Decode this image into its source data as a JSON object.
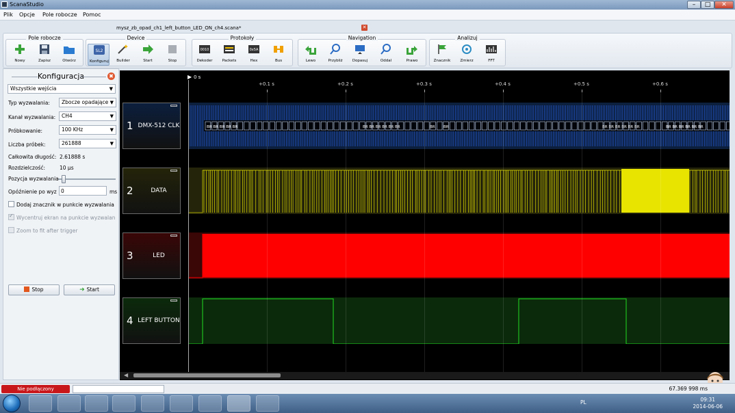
{
  "window": {
    "title": "ScanaStudio",
    "min": "–",
    "max": "□",
    "close": "✕"
  },
  "menu": [
    "Plik",
    "Opcje",
    "Pole robocze",
    "Pomoc"
  ],
  "document_tab": {
    "title": "mysz_zb_opad_ch1_left_button_LED_ON_ch4.scana*",
    "close": "✕"
  },
  "toolbar": {
    "groups": [
      {
        "title": "Pole robocze",
        "buttons": [
          "Nowy",
          "Zapisz",
          "Otwórz"
        ]
      },
      {
        "title": "Device",
        "buttons": [
          "Konfiguruj",
          "Builder",
          "Start",
          "Stop"
        ]
      },
      {
        "title": "Protokoły",
        "buttons": [
          "Dekoder",
          "Packets",
          "Hex",
          "Bus"
        ]
      },
      {
        "title": "Navigation",
        "buttons": [
          "Lewo",
          "Przybliż",
          "Dopasuj",
          "Oddal",
          "Prawo"
        ]
      },
      {
        "title": "Analizuj",
        "buttons": [
          "Znacznik",
          "Zmierz",
          "FFT"
        ]
      }
    ],
    "icon_texts": {
      "konfiguruj": "SL2",
      "dekoder": "0010",
      "hex": "0x5A"
    }
  },
  "config_panel": {
    "title": "Konfiguracja",
    "close": "✖",
    "inputs_select": "Wszystkie wejścia",
    "trigger_type_label": "Typ wyzwalania:",
    "trigger_type_value": "Zbocze opadające",
    "trigger_channel_label": "Kanał wyzwalania:",
    "trigger_channel_value": "CH4",
    "sampling_label": "Próbkowanie:",
    "sampling_value": "100 KHz",
    "samples_label": "Liczba próbek:",
    "samples_value": "261888",
    "total_length_label": "Całkowita długość:",
    "total_length_value": "2.61888 s",
    "resolution_label": "Rozdzielczość:",
    "resolution_value": "10 µs",
    "trigger_pos_label": "Pozycja wyzwalania",
    "trigger_pos_fraction": 0.1,
    "delay_label": "Opóźnienie po wyz",
    "delay_value": "0",
    "delay_unit": "ms",
    "add_marker_label": "Dodaj znacznik w punkcie wyzwalania",
    "center_label": "Wycentruj ekran na punkcie wyzwalan",
    "zoom_label": "Zoom to fit after trigger",
    "stop_button": "Stop",
    "start_button": "Start"
  },
  "ruler": {
    "origin": "0 s",
    "ticks": [
      "+0.1 s",
      "+0.2 s",
      "+0.3 s",
      "+0.4 s",
      "+0.5 s",
      "+0.6 s"
    ]
  },
  "channels": [
    {
      "num": "1",
      "name": "DMX-512 CLK",
      "color": "#2d6cff",
      "bg": "#0c1f3d",
      "decode_labels": [
        "BR",
        "BR",
        "BR",
        "BR",
        "BR",
        "BR",
        "BR",
        "BR",
        "BR",
        "BR",
        "BR",
        "BR",
        "BR",
        "BR",
        "BR",
        "BR",
        "BR",
        "BR",
        "BR",
        "BR",
        "BR",
        "BR",
        "BR",
        "BR",
        "BR"
      ]
    },
    {
      "num": "2",
      "name": "DATA",
      "color": "#e8e400",
      "bg": "#24240a"
    },
    {
      "num": "3",
      "name": "LED",
      "color": "#ff0000",
      "bg": "#3a0606"
    },
    {
      "num": "4",
      "name": "LEFT BUTTON",
      "color": "#22dd22",
      "bg": "#0b2a0b"
    }
  ],
  "status": {
    "connection": "Nie podłączony",
    "cursor_time": "67.369 998 ms"
  },
  "taskbar": {
    "lang": "PL",
    "time": "09:31",
    "date": "2014-06-06"
  }
}
